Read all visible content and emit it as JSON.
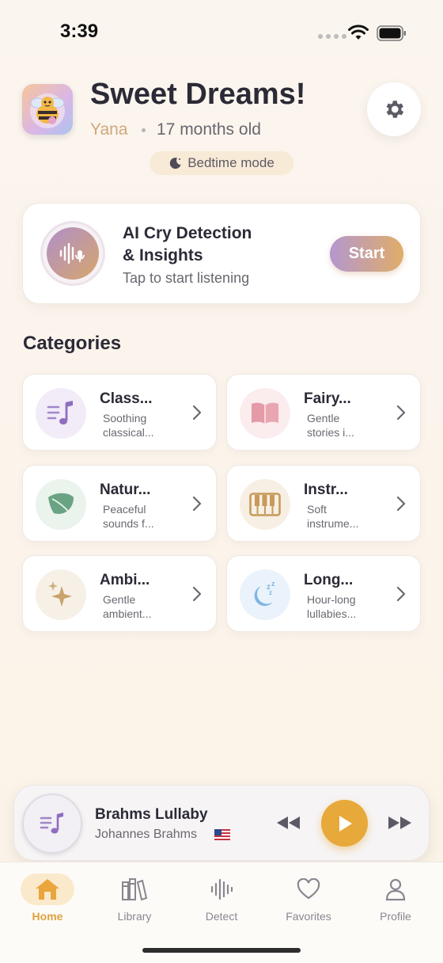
{
  "status": {
    "time": "3:39"
  },
  "header": {
    "greeting": "Sweet Dreams!",
    "baby_name": "Yana",
    "baby_age": "17 months old",
    "bedtime_label": "Bedtime mode"
  },
  "ai_card": {
    "title_line1": "AI Cry Detection",
    "title_line2": "& Insights",
    "subtitle": "Tap to start listening",
    "start_label": "Start"
  },
  "categories": {
    "title": "Categories",
    "items": [
      {
        "title": "Class...",
        "desc1": "Soothing",
        "desc2": "classical...",
        "icon": "music-note-icon",
        "color": "#8f6ec0",
        "bg": "#f1ecf8"
      },
      {
        "title": "Fairy...",
        "desc1": "Gentle",
        "desc2": "stories i...",
        "icon": "book-icon",
        "color": "#e59aa7",
        "bg": "#fbecee"
      },
      {
        "title": "Natur...",
        "desc1": "Peaceful",
        "desc2": "sounds f...",
        "icon": "leaf-icon",
        "color": "#6aa384",
        "bg": "#eaf3ec"
      },
      {
        "title": "Instr...",
        "desc1": "Soft",
        "desc2": "instrume...",
        "icon": "piano-icon",
        "color": "#c79a5a",
        "bg": "#f7efe3"
      },
      {
        "title": "Ambi...",
        "desc1": "Gentle",
        "desc2": "ambient...",
        "icon": "sparkles-icon",
        "color": "#c9a36b",
        "bg": "#f6f0e6"
      },
      {
        "title": "Long...",
        "desc1": "Hour-long",
        "desc2": "lullabies...",
        "icon": "moon-zzz-icon",
        "color": "#7fb5e3",
        "bg": "#eaf3fb"
      }
    ]
  },
  "player": {
    "title": "Brahms Lullaby",
    "artist": "Johannes Brahms",
    "flag": "us-flag"
  },
  "tabs": [
    {
      "label": "Home",
      "icon": "home-icon"
    },
    {
      "label": "Library",
      "icon": "library-icon"
    },
    {
      "label": "Detect",
      "icon": "waveform-icon"
    },
    {
      "label": "Favorites",
      "icon": "heart-icon"
    },
    {
      "label": "Profile",
      "icon": "person-icon"
    }
  ],
  "colors": {
    "accent": "#e7a93a",
    "gradient_start": "#b497cf",
    "gradient_end": "#e0ad68",
    "text": "#2b2a36"
  }
}
